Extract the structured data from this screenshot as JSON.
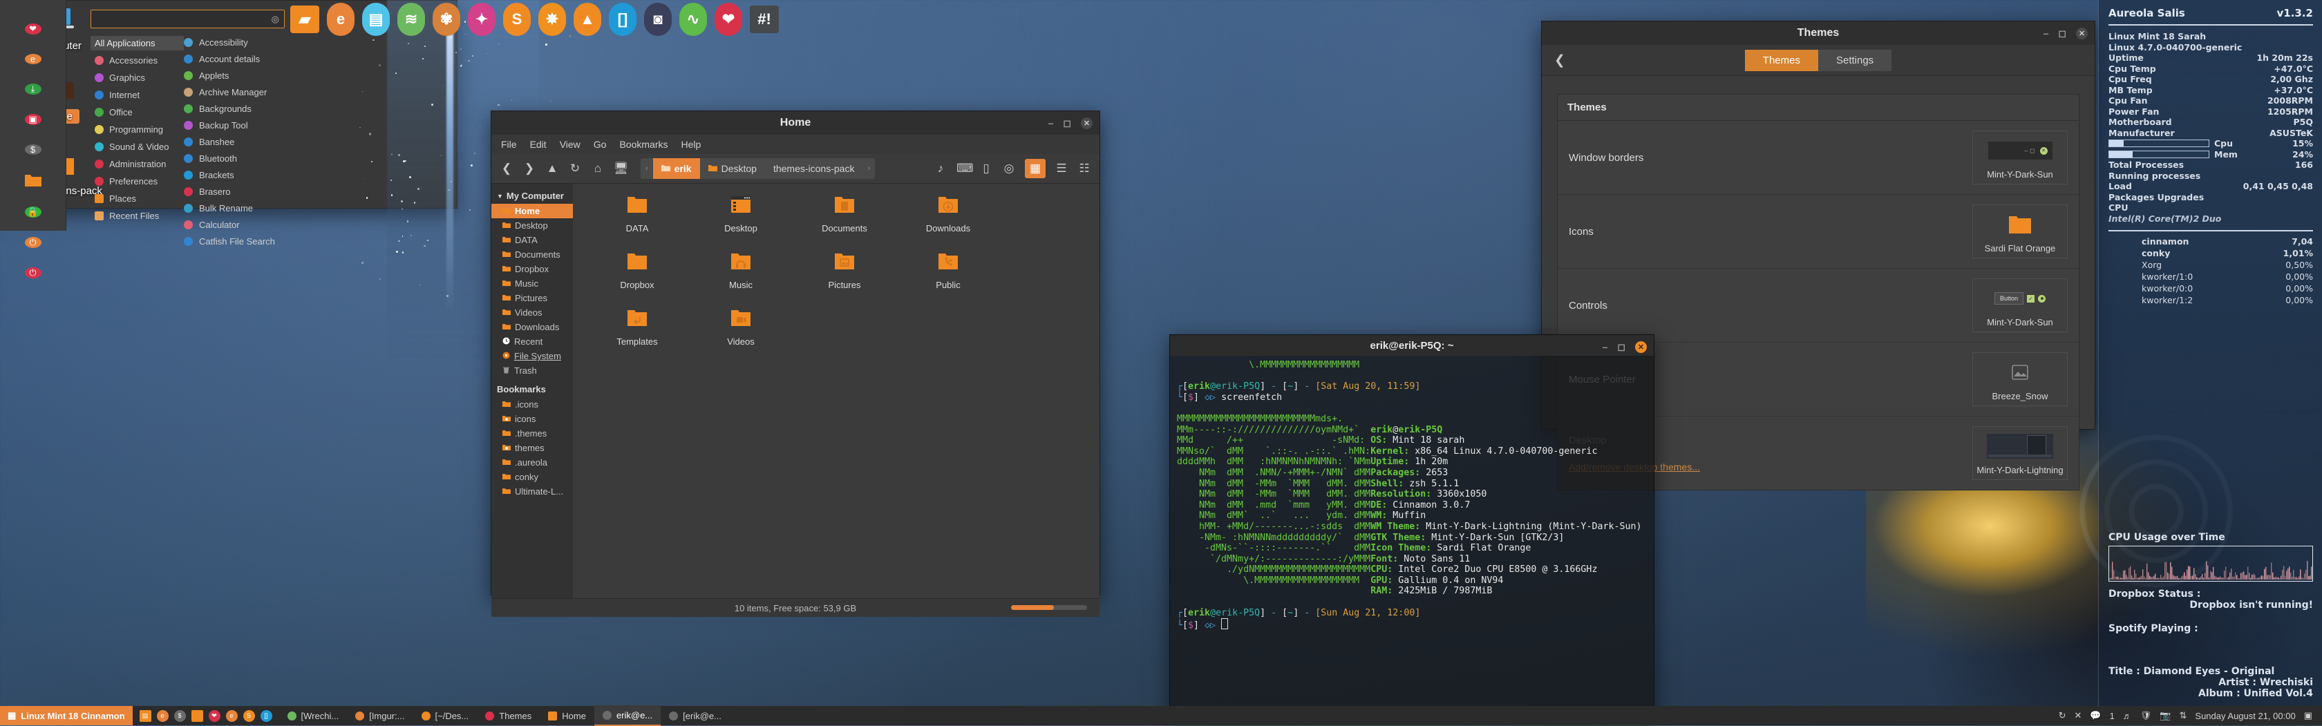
{
  "desktop": {
    "icons": [
      {
        "label": "Computer",
        "icon": "computer-icon",
        "selected": false
      },
      {
        "label": "Home",
        "icon": "folder-home-icon",
        "selected": true
      },
      {
        "label": "themes-icons-pack",
        "icon": "folder-icon",
        "selected": false
      }
    ]
  },
  "dock": {
    "items": [
      {
        "name": "files-icon",
        "glyph": "▰",
        "color": "#f08b24",
        "shape": "square"
      },
      {
        "name": "firefox-icon",
        "glyph": "e",
        "color": "#e8833a"
      },
      {
        "name": "text-editor-icon",
        "glyph": "▤",
        "color": "#4fc3e8"
      },
      {
        "name": "spotify-icon",
        "glyph": "≋",
        "color": "#6db95f"
      },
      {
        "name": "gimp-icon",
        "glyph": "✾",
        "color": "#d8813a"
      },
      {
        "name": "inkscape-icon",
        "glyph": "✦",
        "color": "#d2418a"
      },
      {
        "name": "sublime-icon",
        "glyph": "S",
        "color": "#f08b24"
      },
      {
        "name": "shotcut-icon",
        "glyph": "✸",
        "color": "#f0901f"
      },
      {
        "name": "vlc-icon",
        "glyph": "▲",
        "color": "#f08b24"
      },
      {
        "name": "brackets-icon",
        "glyph": "[]",
        "color": "#1e9bd7"
      },
      {
        "name": "archive-manager-icon",
        "glyph": "◙",
        "color": "#3a3f5c"
      },
      {
        "name": "system-monitor-icon",
        "glyph": "∿",
        "color": "#5fbb4a"
      },
      {
        "name": "brasero-icon",
        "glyph": "❤",
        "color": "#d8324a"
      },
      {
        "name": "terminal-icon",
        "glyph": "#!",
        "color": "#45494c",
        "shape": "square"
      }
    ]
  },
  "nemo": {
    "title": "Home",
    "menus": [
      "File",
      "Edit",
      "View",
      "Go",
      "Bookmarks",
      "Help"
    ],
    "toolbar_icons": [
      "back-icon",
      "forward-icon",
      "up-icon",
      "reload-icon",
      "home-icon",
      "computer-icon"
    ],
    "right_icons": [
      "open-terminal-icon",
      "terminal-icon",
      "new-document-icon",
      "location-icon",
      "icon-view-icon",
      "list-view-icon",
      "compact-view-icon"
    ],
    "breadcrumbs": [
      {
        "label": "erik",
        "selected": true
      },
      {
        "label": "Desktop",
        "selected": false
      },
      {
        "label": "themes-icons-pack",
        "selected": false
      }
    ],
    "sidebar": {
      "header": "My Computer",
      "items": [
        {
          "label": "Home",
          "icon": "folder-home-icon",
          "selected": true
        },
        {
          "label": "Desktop",
          "icon": "folder-desktop-icon",
          "selected": false
        },
        {
          "label": "DATA",
          "icon": "folder-icon",
          "selected": false
        },
        {
          "label": "Documents",
          "icon": "folder-documents-icon",
          "selected": false
        },
        {
          "label": "Dropbox",
          "icon": "folder-dropbox-icon",
          "selected": false
        },
        {
          "label": "Music",
          "icon": "folder-music-icon",
          "selected": false
        },
        {
          "label": "Pictures",
          "icon": "folder-pictures-icon",
          "selected": false
        },
        {
          "label": "Videos",
          "icon": "folder-videos-icon",
          "selected": false
        },
        {
          "label": "Downloads",
          "icon": "folder-downloads-icon",
          "selected": false
        },
        {
          "label": "Recent",
          "icon": "clock-icon",
          "selected": false
        },
        {
          "label": "File System",
          "icon": "disk-icon",
          "selected": false
        },
        {
          "label": "Trash",
          "icon": "trash-icon",
          "selected": false
        }
      ],
      "bookmarks_header": "Bookmarks",
      "bookmarks": [
        {
          "label": ".icons",
          "icon": "folder-icon"
        },
        {
          "label": "icons",
          "icon": "folder-link-icon"
        },
        {
          "label": ".themes",
          "icon": "folder-icon"
        },
        {
          "label": "themes",
          "icon": "folder-link-icon"
        },
        {
          "label": ".aureola",
          "icon": "folder-icon"
        },
        {
          "label": "conky",
          "icon": "folder-icon"
        },
        {
          "label": "Ultimate-L...",
          "icon": "folder-icon"
        }
      ]
    },
    "files": [
      {
        "label": "DATA",
        "icon": "folder-icon"
      },
      {
        "label": "Desktop",
        "icon": "folder-desktop-icon"
      },
      {
        "label": "Documents",
        "icon": "folder-documents-icon"
      },
      {
        "label": "Downloads",
        "icon": "folder-downloads-icon"
      },
      {
        "label": "Dropbox",
        "icon": "folder-icon"
      },
      {
        "label": "Music",
        "icon": "folder-music-icon"
      },
      {
        "label": "Pictures",
        "icon": "folder-pictures-icon"
      },
      {
        "label": "Public",
        "icon": "folder-public-icon"
      },
      {
        "label": "Templates",
        "icon": "folder-templates-icon"
      },
      {
        "label": "Videos",
        "icon": "folder-videos-icon"
      }
    ],
    "status": "10 items, Free space: 53,9 GB"
  },
  "themes_window": {
    "title": "Themes",
    "tabs": [
      {
        "label": "Themes",
        "active": true
      },
      {
        "label": "Settings",
        "active": false
      }
    ],
    "panel_header": "Themes",
    "rows": [
      {
        "name": "Window borders",
        "value": "Mint-Y-Dark-Sun",
        "art": "window-borders-preview"
      },
      {
        "name": "Icons",
        "value": "Sardi Flat Orange",
        "art": "folder-icon"
      },
      {
        "name": "Controls",
        "value": "Mint-Y-Dark-Sun",
        "art": "controls-preview",
        "button_label": "Button"
      },
      {
        "name": "Mouse Pointer",
        "value": "Breeze_Snow",
        "art": "image-icon"
      },
      {
        "name": "Desktop",
        "value": "Mint-Y-Dark-Lightning",
        "art": "desktop-preview"
      }
    ],
    "add_remove_link": "Add/remove desktop themes..."
  },
  "terminal": {
    "title": "erik@erik-P5Q: ~",
    "prompt_user": "erik",
    "prompt_host": "@erik-P5Q",
    "prompt1_path": "[~]",
    "prompt1_date": "[Sat Aug 20, 11:59]",
    "command": "screenfetch",
    "prompt2_date": "[Sun Aug 21, 12:00]",
    "dollar": "$",
    "fetch_header": "erik@erik-P5Q",
    "fetch": [
      {
        "k": "OS:",
        "v": "Mint 18 sarah"
      },
      {
        "k": "Kernel:",
        "v": "x86_64 Linux 4.7.0-040700-generic"
      },
      {
        "k": "Uptime:",
        "v": "1h 20m"
      },
      {
        "k": "Packages:",
        "v": "2653"
      },
      {
        "k": "Shell:",
        "v": "zsh 5.1.1"
      },
      {
        "k": "Resolution:",
        "v": "3360x1050"
      },
      {
        "k": "DE:",
        "v": "Cinnamon 3.0.7"
      },
      {
        "k": "WM:",
        "v": "Muffin"
      },
      {
        "k": "WM Theme:",
        "v": "Mint-Y-Dark-Lightning (Mint-Y-Dark-Sun)"
      },
      {
        "k": "GTK Theme:",
        "v": "Mint-Y-Dark-Sun [GTK2/3]"
      },
      {
        "k": "Icon Theme:",
        "v": "Sardi Flat Orange"
      },
      {
        "k": "Font:",
        "v": "Noto Sans 11"
      },
      {
        "k": "CPU:",
        "v": "Intel Core2 Duo CPU E8500 @ 3.166GHz"
      },
      {
        "k": "GPU:",
        "v": "Gallium 0.4 on NV94"
      },
      {
        "k": "RAM:",
        "v": "2425MiB / 7987MiB"
      }
    ],
    "ascii": [
      "             \\.MMMMMMMMMMMMMMMMMM",
      "",
      "MMMMMMMMMMMMMMMMMMMMMMMMMmds+.",
      "MMm----::-://////////////oymNMd+`",
      "MMd      /++                -sNMd:",
      "MMNso/`  dMM    `.::-. .-::.` .hMN:",
      "ddddMMh  dMM   :hNMNMNhNMNMNh: `NMm",
      "    NMm  dMM  .NMN/-+MMM+-/NMN` dMM",
      "    NMm  dMM  -MMm  `MMM   dMM. dMM",
      "    NMm  dMM  -MMm  `MMM   dMM. dMM",
      "    NMm  dMM  .mmd  `mmm   yMM. dMM",
      "    NMm  dMM`  ..`   ...   ydm. dMM",
      "    hMM- +MMd/-------...-:sdds  dMM",
      "    -NMm- :hNMNNNmdddddddddy/`  dMM",
      "     -dMNs-``-::::-------.``    dMM",
      "      `/dMNmy+/:-------------:/yMMM",
      "         ./ydNMMMMMMMMMMMMMMMMMMMMM",
      "            \\.MMMMMMMMMMMMMMMMMMM"
    ]
  },
  "menu": {
    "search_placeholder": "",
    "search_value": "",
    "favorites": [
      {
        "name": "brasero-icon",
        "glyph": "❤",
        "color": "#d8324a"
      },
      {
        "name": "firefox-icon",
        "glyph": "e",
        "color": "#e8833a"
      },
      {
        "name": "software-manager-icon",
        "glyph": "⤓",
        "color": "#2f9e44"
      },
      {
        "name": "video-icon",
        "glyph": "▣",
        "color": "#d8324a"
      },
      {
        "name": "terminal-icon",
        "glyph": "$",
        "color": "#6b6b6b"
      },
      {
        "name": "files-icon",
        "glyph": "",
        "color": "#f08b24",
        "shape": "folder"
      },
      {
        "name": "lock-icon",
        "glyph": "🔒",
        "color": "#2fb83c"
      },
      {
        "name": "logout-icon",
        "glyph": "⏻",
        "color": "#e8833a"
      },
      {
        "name": "shutdown-icon",
        "glyph": "⏻",
        "color": "#d8324a"
      }
    ],
    "categories": [
      {
        "label": "All Applications",
        "color": "",
        "selected": true
      },
      {
        "label": "Accessories",
        "color": "#e15f73"
      },
      {
        "label": "Graphics",
        "color": "#b355cc"
      },
      {
        "label": "Internet",
        "color": "#2f7fd0"
      },
      {
        "label": "Office",
        "color": "#45a84a"
      },
      {
        "label": "Programming",
        "color": "#e0cc55"
      },
      {
        "label": "Sound & Video",
        "color": "#2bb6c9"
      },
      {
        "label": "Administration",
        "color": "#d8324a"
      },
      {
        "label": "Preferences",
        "color": "#d8324a"
      },
      {
        "label": "Places",
        "color": "#f08b24"
      },
      {
        "label": "Recent Files",
        "color": "#e8a35a"
      }
    ],
    "applications": [
      {
        "label": "Accessibility",
        "color": "#4a9fd4"
      },
      {
        "label": "Account details",
        "color": "#2f86d0"
      },
      {
        "label": "Applets",
        "color": "#66b84a"
      },
      {
        "label": "Archive Manager",
        "color": "#c8a278"
      },
      {
        "label": "Backgrounds",
        "color": "#4fae4f"
      },
      {
        "label": "Backup Tool",
        "color": "#b355cc"
      },
      {
        "label": "Banshee",
        "color": "#2f86d0"
      },
      {
        "label": "Bluetooth",
        "color": "#2f86d0"
      },
      {
        "label": "Brackets",
        "color": "#1e9bd7"
      },
      {
        "label": "Brasero",
        "color": "#d8324a"
      },
      {
        "label": "Bulk Rename",
        "color": "#2f9fc9"
      },
      {
        "label": "Calculator",
        "color": "#e15f73"
      },
      {
        "label": "Catfish File Search",
        "color": "#2f86d0"
      }
    ]
  },
  "conky": {
    "title": "Aureola Salis",
    "version": "v1.3.2",
    "stats": [
      {
        "k": "Linux Mint 18 Sarah",
        "v": ""
      },
      {
        "k": "Linux 4.7.0-040700-generic",
        "v": ""
      },
      {
        "k": "Uptime",
        "v": "1h 20m 22s"
      },
      {
        "k": "Cpu Temp",
        "v": "+47.0°C"
      },
      {
        "k": "Cpu Freq",
        "v": "2,00 Ghz"
      },
      {
        "k": "MB Temp",
        "v": "+37.0°C"
      },
      {
        "k": "Cpu Fan",
        "v": "2008RPM"
      },
      {
        "k": "Power Fan",
        "v": "1205RPM"
      },
      {
        "k": "Motherboard",
        "v": "P5Q"
      },
      {
        "k": "Manufacturer",
        "v": "ASUSTeK"
      }
    ],
    "bars": [
      {
        "label": "Cpu",
        "value": "15%",
        "pct": 15
      },
      {
        "label": "Mem",
        "value": "24%",
        "pct": 24
      }
    ],
    "stats2": [
      {
        "k": "Total Processes",
        "v": "166"
      },
      {
        "k": "Running processes",
        "v": ""
      },
      {
        "k": "Load",
        "v": "0,41 0,45 0,48"
      },
      {
        "k": "Packages Upgrades",
        "v": ""
      },
      {
        "k": "CPU",
        "v": ""
      }
    ],
    "cpu_model": "Intel(R) Core(TM)2 Duo",
    "processes": [
      {
        "name": "cinnamon",
        "value": "7,04"
      },
      {
        "name": "conky",
        "value": "1,01%"
      },
      {
        "name": "Xorg",
        "value": "0,50%"
      },
      {
        "name": "kworker/1:0",
        "value": "0,00%"
      },
      {
        "name": "kworker/0:0",
        "value": "0,00%"
      },
      {
        "name": "kworker/1:2",
        "value": "0,00%"
      }
    ],
    "graph_title": "CPU Usage over Time",
    "dropbox_label": "Dropbox Status :",
    "dropbox_value": "Dropbox isn't running!",
    "spotify_label": "Spotify Playing :",
    "track_title": "Title : Diamond Eyes - Original",
    "track_artist": "Artist : Wrechiski",
    "track_album": "Album : Unified Vol.4"
  },
  "taskbar": {
    "menu_label": "Linux Mint 18 Cinnamon",
    "quick_launch": [
      {
        "name": "files-icon",
        "glyph": "▤",
        "color": "#f08b24"
      },
      {
        "name": "firefox-icon",
        "glyph": "e",
        "color": "#e8833a"
      },
      {
        "name": "terminal-icon",
        "glyph": "$",
        "color": "#6b6b6b"
      },
      {
        "name": "folder-icon",
        "glyph": "",
        "color": "#f08b24"
      },
      {
        "name": "brasero-icon",
        "glyph": "❤",
        "color": "#d8324a"
      },
      {
        "name": "firefox2-icon",
        "glyph": "e",
        "color": "#e8833a"
      },
      {
        "name": "sublime-icon",
        "glyph": "S",
        "color": "#f08b24"
      },
      {
        "name": "brackets-icon",
        "glyph": "[]",
        "color": "#1e9bd7"
      }
    ],
    "tasks": [
      {
        "label": "[Wrechi...",
        "icon": "spotify-icon",
        "color": "#6db95f",
        "active": false
      },
      {
        "label": "[Imgur:...",
        "icon": "firefox-icon",
        "color": "#e8833a",
        "active": false
      },
      {
        "label": "[~/Des...",
        "icon": "sublime-icon",
        "color": "#f08b24",
        "active": false
      },
      {
        "label": "Themes",
        "icon": "themes-icon",
        "color": "#d8324a",
        "active": false
      },
      {
        "label": "Home",
        "icon": "folder-icon",
        "color": "#f08b24",
        "active": false
      },
      {
        "label": "erik@e...",
        "icon": "terminal-icon",
        "color": "#6b6b6b",
        "active": true
      },
      {
        "label": "[erik@e...",
        "icon": "terminal-icon",
        "color": "#6b6b6b",
        "active": false
      }
    ],
    "tray": [
      "reload-icon",
      "close-icon",
      "messages-icon",
      "1",
      "music-icon",
      "shield-icon",
      "screenshot-icon",
      "network-icon"
    ],
    "clock": "Sunday August 21, 00:00",
    "workspace_icon": "workspace-icon"
  }
}
